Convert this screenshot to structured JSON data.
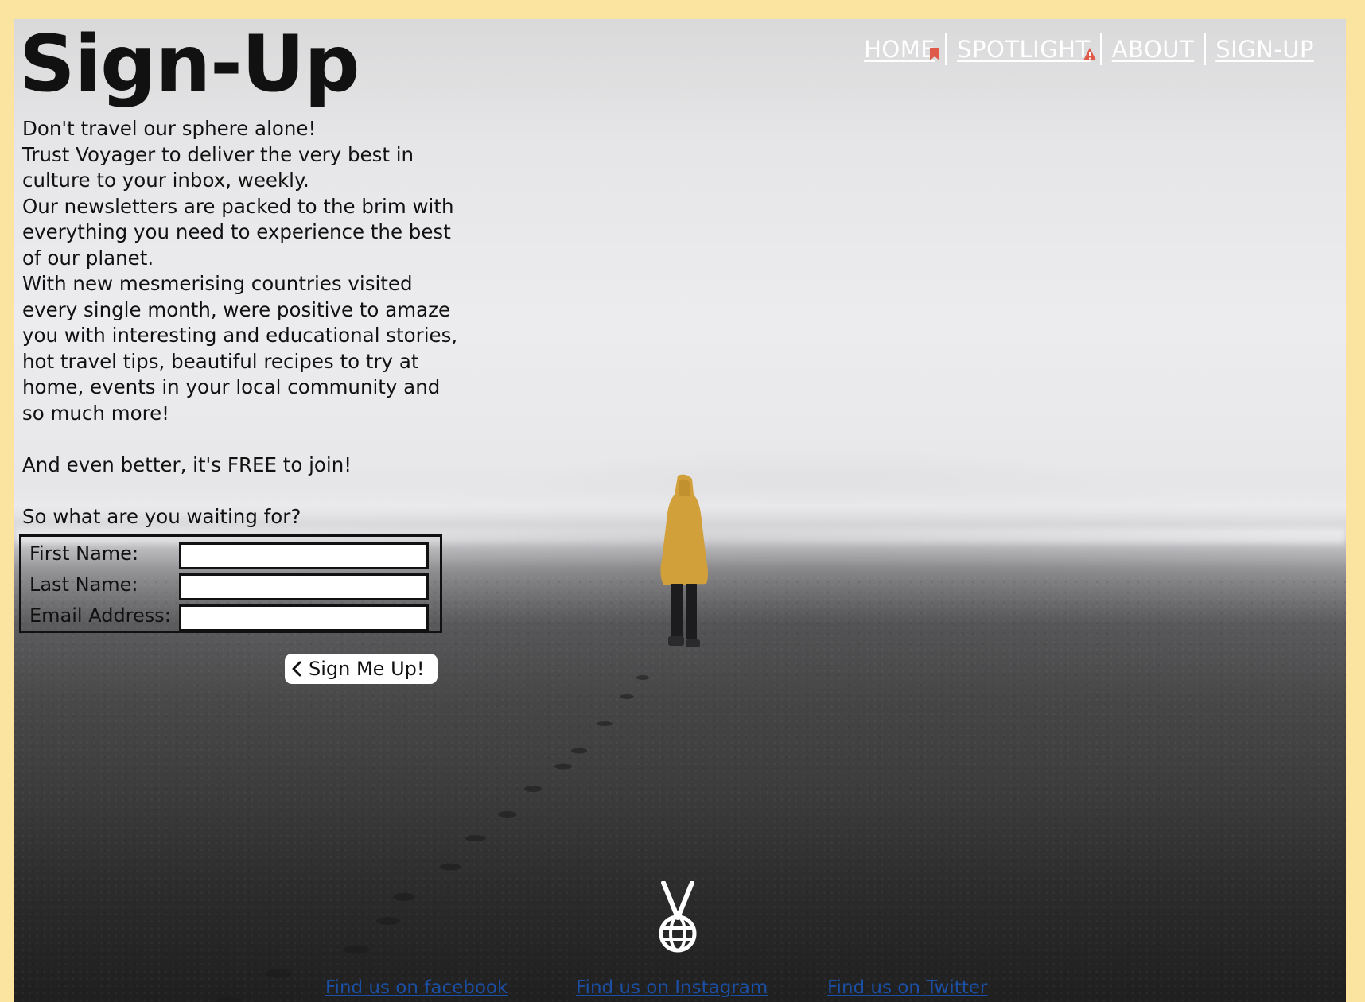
{
  "page": {
    "title": "Sign-Up"
  },
  "nav": {
    "items": [
      {
        "label": "HOME",
        "badge": "bookmark-icon"
      },
      {
        "label": "SPOTLIGHT",
        "badge": "warning-icon"
      },
      {
        "label": "ABOUT"
      },
      {
        "label": "SIGN-UP"
      }
    ]
  },
  "intro": {
    "paragraphs": [
      "Don't travel our sphere alone!",
      "Trust Voyager to deliver the very best in culture to your inbox, weekly.",
      "Our newsletters are packed to the brim with everything you need to experience the best of our planet.",
      "With new mesmerising countries visited every single month, were positive to amaze you with interesting and educational stories, hot travel tips, beautiful recipes to try at home, events in your local community and so much more!",
      "And even better, it's FREE to join!",
      "So what are you waiting for?"
    ]
  },
  "form": {
    "fields": [
      {
        "label": "First Name:",
        "value": ""
      },
      {
        "label": "Last Name:",
        "value": ""
      },
      {
        "label": "Email Address:",
        "value": ""
      }
    ],
    "submit_label": "Sign Me Up!"
  },
  "footer": {
    "links": [
      "Find us on facebook",
      "Find us on Instagram",
      "Find us on Twitter"
    ]
  },
  "colors": {
    "page_border": "#fbe3a0",
    "nav_text": "#ffffff",
    "footer_link": "#1b4fa3",
    "raincoat": "#d9a73a"
  },
  "icons": {
    "logo": "voyager-globe-logo-icon",
    "button_chevron": "chevron-left-icon"
  }
}
